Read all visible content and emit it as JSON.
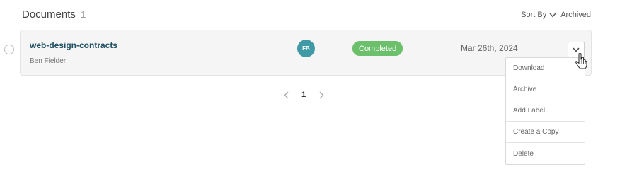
{
  "header": {
    "title": "Documents",
    "count": "1",
    "sort_label": "Sort By",
    "archived_label": "Archived"
  },
  "document": {
    "name": "web-design-contracts",
    "owner": "Ben Fielder",
    "avatar_initials": "FB",
    "status": "Completed",
    "date": "Mar 26th, 2024"
  },
  "menu": {
    "items": [
      "Download",
      "Archive",
      "Add Label",
      "Create a Copy",
      "Delete"
    ]
  },
  "pagination": {
    "current_page": "1"
  },
  "colors": {
    "doc_name": "#1f4f63",
    "avatar": "#3f9aa6",
    "status_completed": "#6cc06c"
  }
}
